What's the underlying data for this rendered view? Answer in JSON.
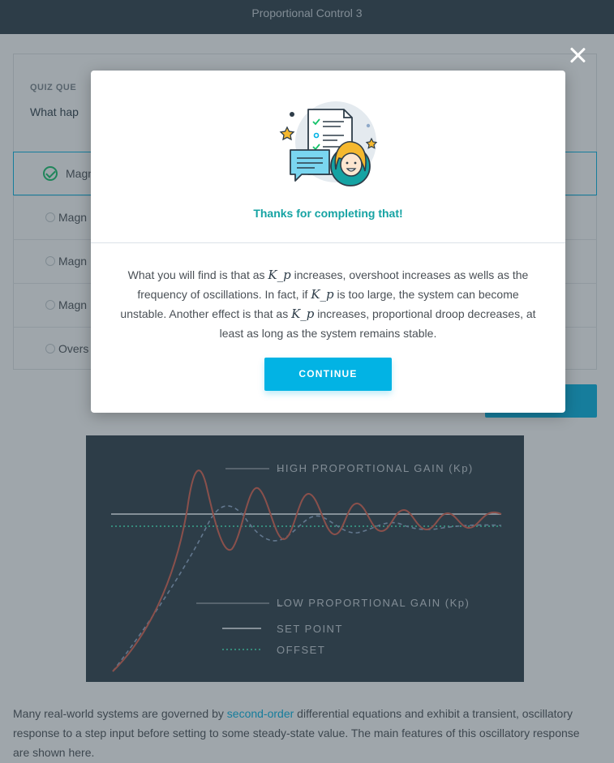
{
  "topbar": {
    "title": "Proportional Control 3"
  },
  "quiz": {
    "label": "QUIZ QUE",
    "question": "What hap",
    "options": [
      {
        "text": "Magn",
        "selected": true
      },
      {
        "text": "Magn",
        "selected": false
      },
      {
        "text": "Magn",
        "selected": false
      },
      {
        "text": "Magn",
        "selected": false
      },
      {
        "text": "Overs",
        "selected": false
      }
    ]
  },
  "chart_data": {
    "type": "line",
    "title": "",
    "series": [
      {
        "name": "HIGH PROPORTIONAL GAIN (Kp)",
        "style": "solid",
        "color": "#d9604f"
      },
      {
        "name": "LOW PROPORTIONAL GAIN (Kp)",
        "style": "dashed",
        "color": "#8fa9c9"
      },
      {
        "name": "SET POINT",
        "style": "solid",
        "color": "#d0d6dc"
      },
      {
        "name": "OFFSET",
        "style": "dotted",
        "color": "#3ec9a7"
      }
    ],
    "grid": false,
    "legend": "right"
  },
  "paragraph": {
    "before": "Many real-world systems are governed by ",
    "link": "second-order",
    "after": " differential equations and exhibit a transient, oscillatory response to a step input before setting to some steady-state value. The main features of this oscillatory response are shown here."
  },
  "modal": {
    "thanks": "Thanks for completing that!",
    "body": {
      "t1": "What you will find is that as ",
      "m1": "K_p",
      "t2": " increases, overshoot increases as wells as the frequency of oscillations. In fact, if ",
      "m2": "K_p",
      "t3": " is too large, the system can become unstable. Another effect is that as ",
      "m3": "K_p",
      "t4": " increases, proportional droop decreases, at least as long as the system remains stable."
    },
    "continue_label": "CONTINUE"
  },
  "colors": {
    "accent": "#02b3e4",
    "success": "#15c26b",
    "teal": "#15a3a3",
    "header": "#2e3d49"
  }
}
